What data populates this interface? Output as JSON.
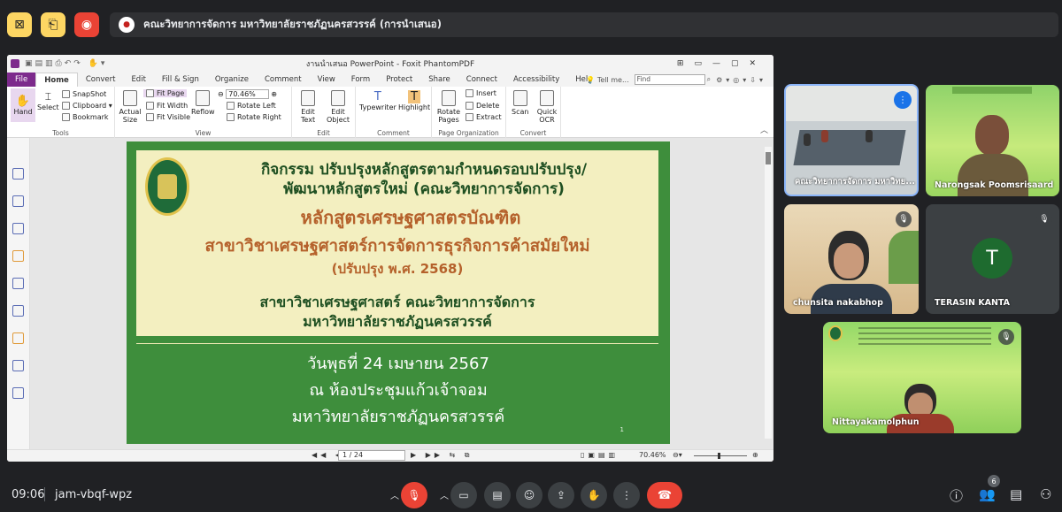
{
  "top": {
    "presentation_title": "คณะวิทยาการจัดการ มหาวิทยาลัยราชภัฏนครสวรรค์ (การนำเสนอ)"
  },
  "app": {
    "window_title": "งานนำเสนอ PowerPoint - Foxit PhantomPDF",
    "search_placeholder": "Find",
    "tell_me": "Tell me...",
    "tabs": [
      "File",
      "Home",
      "Convert",
      "Edit",
      "Fill & Sign",
      "Organize",
      "Comment",
      "View",
      "Form",
      "Protect",
      "Share",
      "Connect",
      "Accessibility",
      "Help"
    ],
    "ribbon": {
      "hand": "Hand",
      "select": "Select",
      "snapshot": "SnapShot",
      "clipboard": "Clipboard",
      "bookmark": "Bookmark",
      "tools_label": "Tools",
      "actual_size": "Actual Size",
      "fit_page": "Fit Page",
      "fit_width": "Fit Width",
      "fit_visible": "Fit Visible",
      "reflow": "Reflow",
      "zoom": "70.46%",
      "rotate_left": "Rotate Left",
      "rotate_right": "Rotate Right",
      "view_label": "View",
      "edit_text": "Edit Text",
      "edit_object": "Edit Object",
      "edit_label": "Edit",
      "typewriter": "Typewriter",
      "highlight": "Highlight",
      "comment_label": "Comment",
      "rotate_pages": "Rotate Pages",
      "insert": "Insert",
      "delete": "Delete",
      "extract": "Extract",
      "page_org_label": "Page Organization",
      "scan": "Scan",
      "quick_ocr": "Quick OCR",
      "convert_label": "Convert"
    },
    "status": {
      "page": "1 / 24",
      "zoom": "70.46%"
    }
  },
  "slide": {
    "line1": "กิจกรรม ปรับปรุงหลักสูตรตามกำหนดรอบปรับปรุง/",
    "line2": "พัฒนาหลักสูตรใหม่ (คณะวิทยาการจัดการ)",
    "line3": "หลักสูตรเศรษฐศาสตรบัณฑิต",
    "line4": "สาขาวิชาเศรษฐศาสตร์การจัดการธุรกิจการค้าสมัยใหม่",
    "line5": "(ปรับปรุง พ.ศ. 2568)",
    "line6": "สาขาวิชาเศรษฐศาสตร์ คณะวิทยาการจัดการ",
    "line7": "มหาวิทยาลัยราชภัฏนครสวรรค์",
    "line8": "วันพุธที่ 24 เมษายน 2567",
    "line9": "ณ ห้องประชุมแก้วเจ้าจอม",
    "line10": "มหาวิทยาลัยราชภัฏนครสวรรค์",
    "page_num": "1"
  },
  "participants": [
    {
      "name": "คณะวิทยาการจัดการ มหาวิทย..."
    },
    {
      "name": "Narongsak Poomsrisaard"
    },
    {
      "name": "chunsita nakabhop"
    },
    {
      "name": "TERASIN KANTA",
      "initial": "T"
    },
    {
      "name": "Nittayakamolphun"
    }
  ],
  "bottom": {
    "time": "09:06",
    "meeting_code": "jam-vbqf-wpz",
    "people_count": "6"
  },
  "colors": {
    "slide_green": "#3e8e3c",
    "slide_cream": "#f3efc0",
    "thai_brown": "#b5612b",
    "end_call": "#ea4335",
    "foxit_purple": "#7d2a8c"
  }
}
